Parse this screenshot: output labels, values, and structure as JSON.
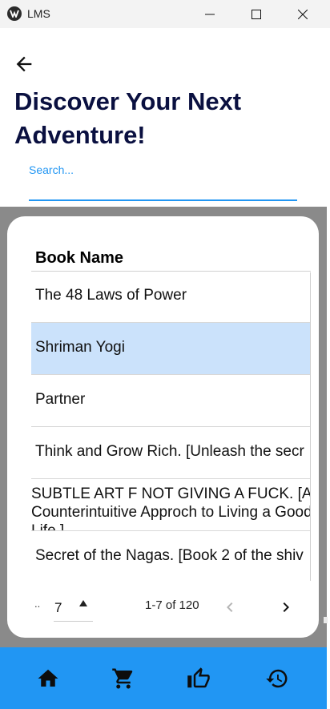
{
  "window": {
    "title": "LMS"
  },
  "page": {
    "title": "Discover Your Next Adventure!"
  },
  "search": {
    "placeholder": "Search..."
  },
  "table": {
    "header": "Book Name",
    "rows": [
      {
        "name": "The 48 Laws of Power",
        "selected": false
      },
      {
        "name": "Shriman Yogi",
        "selected": true
      },
      {
        "name": "Partner",
        "selected": false
      },
      {
        "name": "Think and Grow Rich. [Unleash the secr",
        "selected": false
      },
      {
        "name": "SUBTLE ART F NOT GIVING A FUCK. [A Counterintuitive Approch to Living a Good Life ]",
        "selected": false
      },
      {
        "name": "Secret of the Nagas. [Book 2 of the shiv",
        "selected": false
      }
    ]
  },
  "pagination": {
    "ellipsis": "..",
    "rows_per_page": "7",
    "range": "1-7 of 120"
  },
  "bottom_nav": {
    "items": [
      "home-icon",
      "cart-icon",
      "thumb-up-icon",
      "history-icon"
    ]
  },
  "colors": {
    "accent": "#2196f3",
    "title": "#0a1040",
    "selected_row": "#cbe2fb"
  }
}
